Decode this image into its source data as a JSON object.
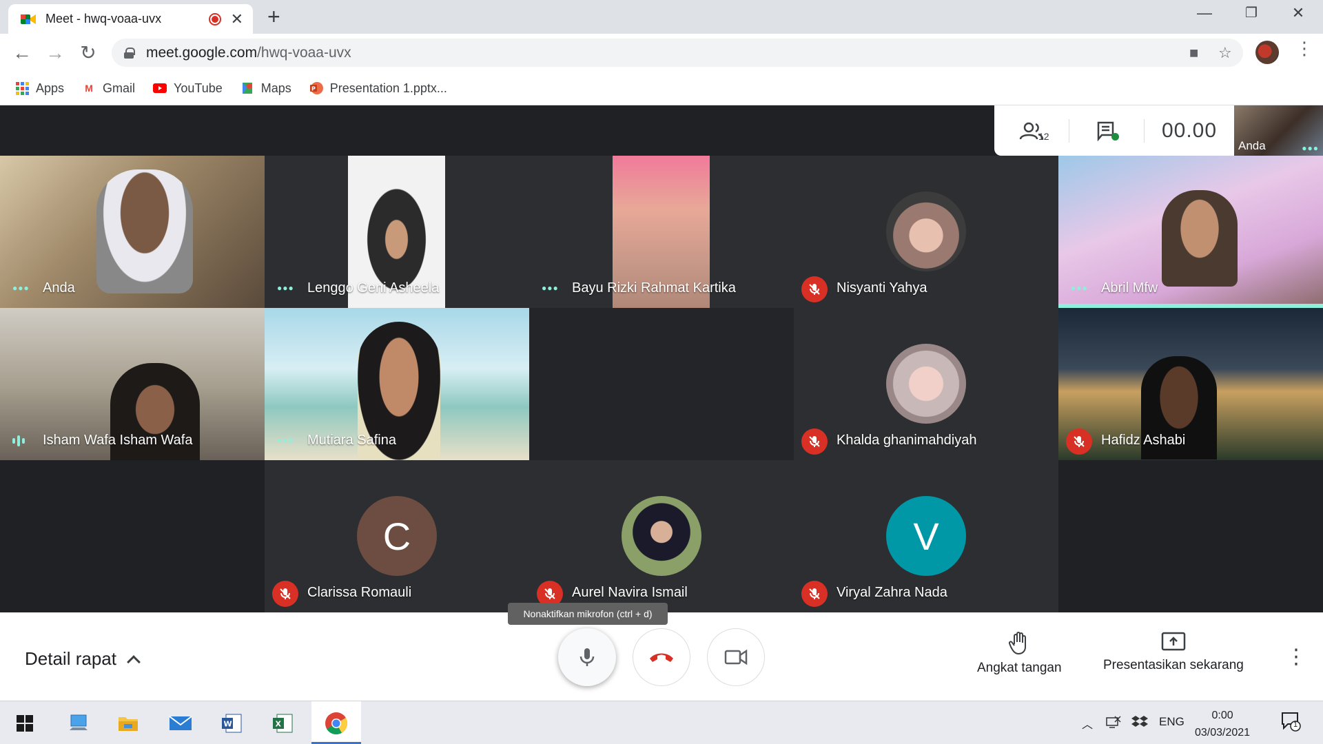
{
  "browser": {
    "tab_title": "Meet - hwq-voaa-uvx",
    "url_host": "meet.google.com",
    "url_path": "/hwq-voaa-uvx",
    "bookmarks": [
      {
        "label": "Apps",
        "icon": "apps-grid-icon"
      },
      {
        "label": "Gmail",
        "icon": "gmail-icon",
        "color": "#ea4335"
      },
      {
        "label": "YouTube",
        "icon": "youtube-icon",
        "color": "#ff0000"
      },
      {
        "label": "Maps",
        "icon": "maps-icon",
        "color": "#34a853"
      },
      {
        "label": "Presentation 1.pptx...",
        "icon": "powerpoint-icon",
        "color": "#d24726"
      }
    ]
  },
  "meeting": {
    "participant_count": "12",
    "timer": "00.00",
    "self_label": "Anda",
    "participants": [
      {
        "name": "Anda",
        "status": "speaking-dots"
      },
      {
        "name": "Lenggo Geni Asheela",
        "status": "speaking-dots"
      },
      {
        "name": "Bayu Rizki Rahmat Kartika",
        "status": "speaking-dots"
      },
      {
        "name": "Nisyanti Yahya",
        "status": "muted"
      },
      {
        "name": "Abril Mfw",
        "status": "speaking-dots"
      },
      {
        "name": "Isham Wafa Isham Wafa",
        "status": "speaking"
      },
      {
        "name": "Mutiara Safina",
        "status": "speaking-dots"
      },
      {
        "name": "Khalda ghanimahdiyah",
        "status": "muted"
      },
      {
        "name": "Hafidz Ashabi",
        "status": "muted"
      },
      {
        "name": "Clarissa Romauli",
        "status": "muted",
        "initial": "C",
        "avatar_color": "#6d4c41"
      },
      {
        "name": "Aurel Navira Ismail",
        "status": "muted"
      },
      {
        "name": "Viryal Zahra Nada",
        "status": "muted",
        "initial": "V",
        "avatar_color": "#0097a7"
      }
    ]
  },
  "controls": {
    "detail_label": "Detail rapat",
    "mic_tooltip": "Nonaktifkan mikrofon (ctrl + d)",
    "raise_hand_label": "Angkat tangan",
    "present_label": "Presentasikan sekarang"
  },
  "taskbar": {
    "language": "ENG",
    "time": "0:00",
    "date": "03/03/2021",
    "notification_count": "1"
  },
  "colors": {
    "accent_teal": "#8ef0dc",
    "mute_red": "#d93025",
    "meet_bg": "#202124"
  }
}
